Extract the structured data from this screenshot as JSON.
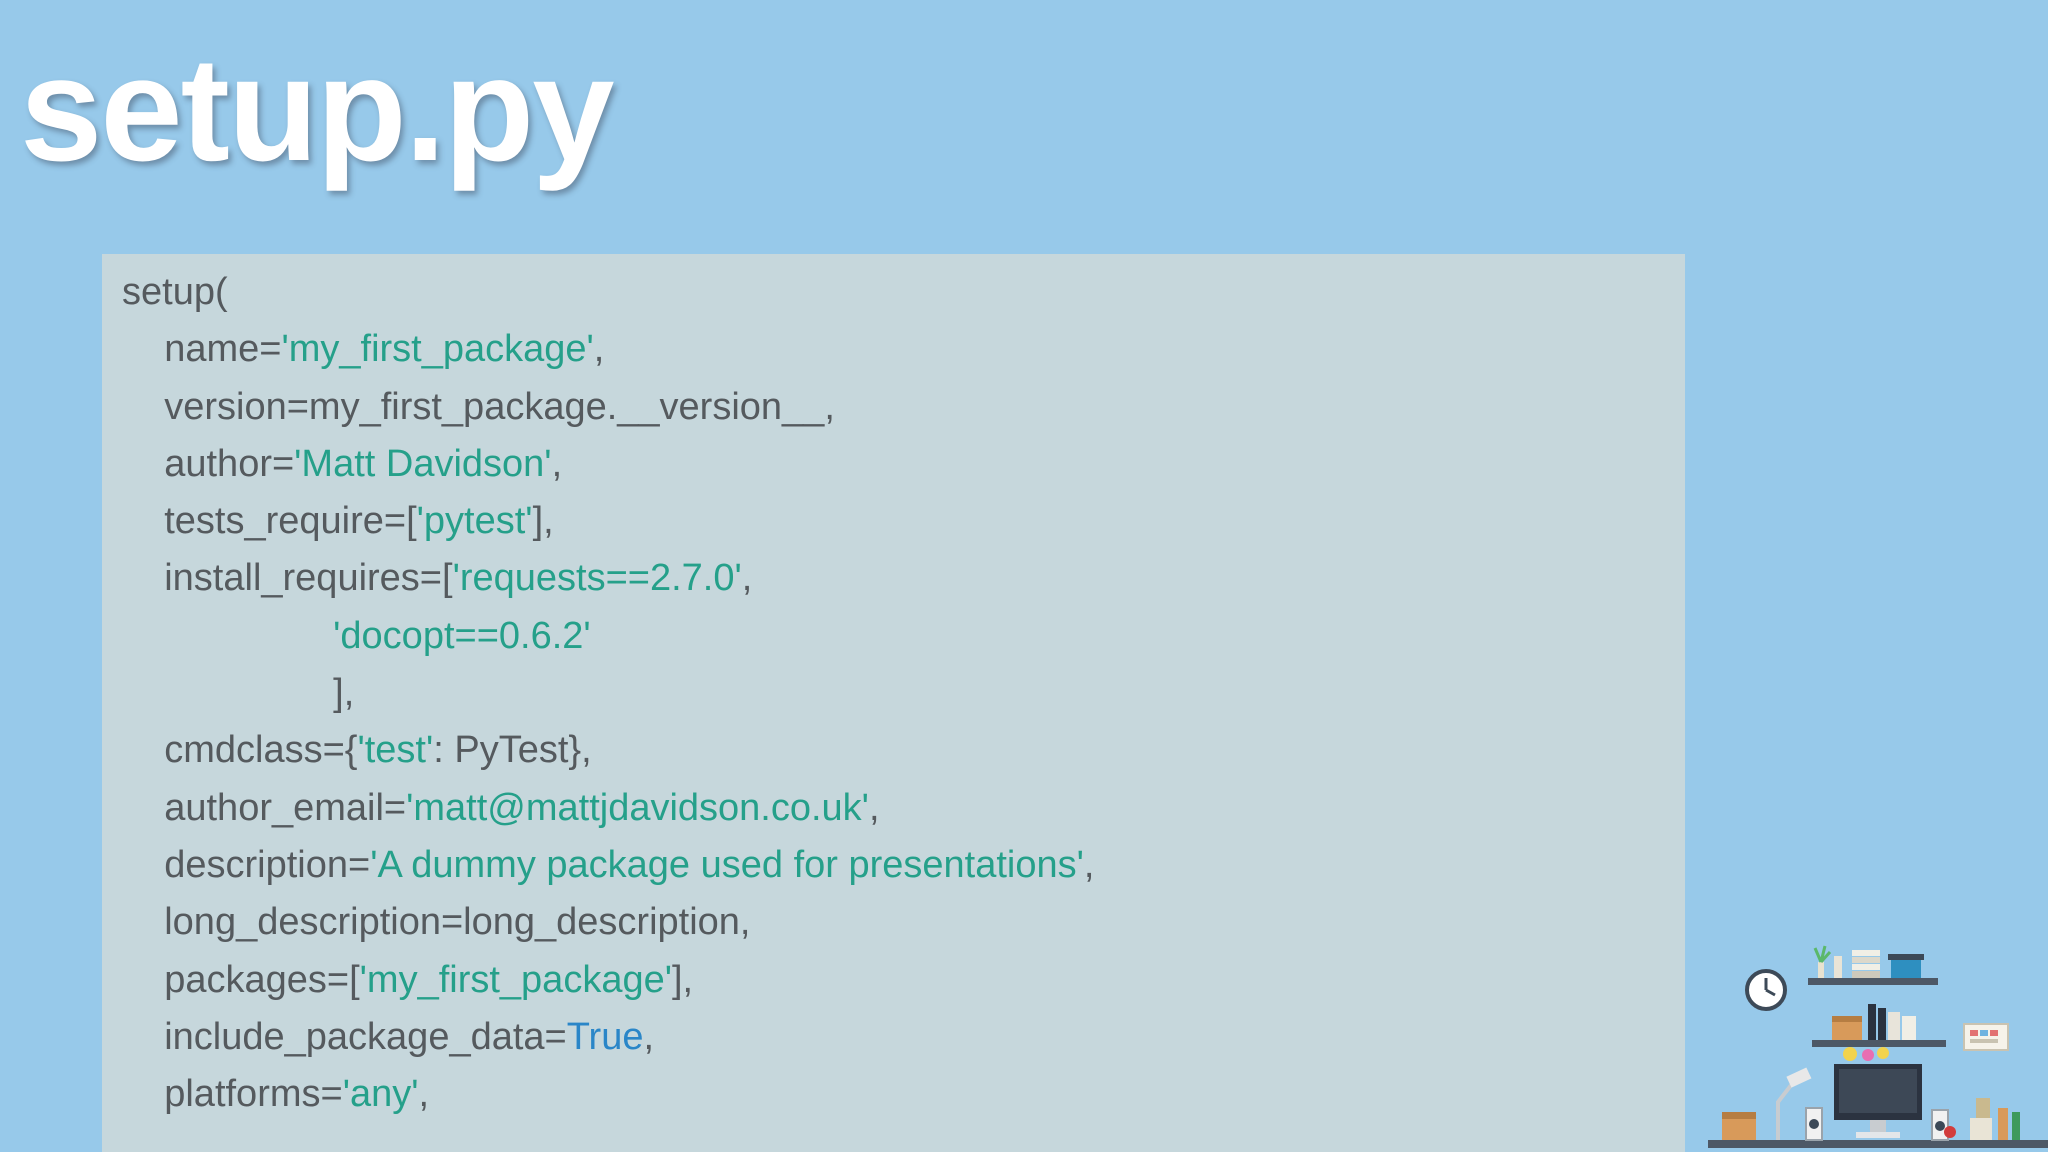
{
  "slide": {
    "title": "setup.py"
  },
  "code": {
    "lines": [
      {
        "tokens": [
          {
            "t": "setup(",
            "k": "plain"
          }
        ]
      },
      {
        "tokens": [
          {
            "t": "    name=",
            "k": "plain"
          },
          {
            "t": "'my_first_package'",
            "k": "str"
          },
          {
            "t": ",",
            "k": "plain"
          }
        ]
      },
      {
        "tokens": [
          {
            "t": "    version=my_first_package.__version__,",
            "k": "plain"
          }
        ]
      },
      {
        "tokens": [
          {
            "t": "    author=",
            "k": "plain"
          },
          {
            "t": "'Matt Davidson'",
            "k": "str"
          },
          {
            "t": ",",
            "k": "plain"
          }
        ]
      },
      {
        "tokens": [
          {
            "t": "    tests_require=[",
            "k": "plain"
          },
          {
            "t": "'pytest'",
            "k": "str"
          },
          {
            "t": "],",
            "k": "plain"
          }
        ]
      },
      {
        "tokens": [
          {
            "t": "    install_requires=[",
            "k": "plain"
          },
          {
            "t": "'requests==2.7.0'",
            "k": "str"
          },
          {
            "t": ",",
            "k": "plain"
          }
        ]
      },
      {
        "tokens": [
          {
            "t": "                    ",
            "k": "plain"
          },
          {
            "t": "'docopt==0.6.2'",
            "k": "str"
          }
        ]
      },
      {
        "tokens": [
          {
            "t": "                    ],",
            "k": "plain"
          }
        ]
      },
      {
        "tokens": [
          {
            "t": "    cmdclass={",
            "k": "plain"
          },
          {
            "t": "'test'",
            "k": "str"
          },
          {
            "t": ": PyTest},",
            "k": "plain"
          }
        ]
      },
      {
        "tokens": [
          {
            "t": "    author_email=",
            "k": "plain"
          },
          {
            "t": "'matt@mattjdavidson.co.uk'",
            "k": "str"
          },
          {
            "t": ",",
            "k": "plain"
          }
        ]
      },
      {
        "tokens": [
          {
            "t": "    description=",
            "k": "plain"
          },
          {
            "t": "'A dummy package used for presentations'",
            "k": "str"
          },
          {
            "t": ",",
            "k": "plain"
          }
        ]
      },
      {
        "tokens": [
          {
            "t": "    long_description=long_description,",
            "k": "plain"
          }
        ]
      },
      {
        "tokens": [
          {
            "t": "    packages=[",
            "k": "plain"
          },
          {
            "t": "'my_first_package'",
            "k": "str"
          },
          {
            "t": "],",
            "k": "plain"
          }
        ]
      },
      {
        "tokens": [
          {
            "t": "    include_package_data=",
            "k": "plain"
          },
          {
            "t": "True",
            "k": "kw"
          },
          {
            "t": ",",
            "k": "plain"
          }
        ]
      },
      {
        "tokens": [
          {
            "t": "    platforms=",
            "k": "plain"
          },
          {
            "t": "'any'",
            "k": "str"
          },
          {
            "t": ",",
            "k": "plain"
          }
        ]
      }
    ]
  },
  "colors": {
    "background": "#97c9ea",
    "code_background": "#c6d7dc",
    "plain_text": "#555a5e",
    "string_literal": "#25a08a",
    "keyword": "#2a86c8",
    "title_text": "#ffffff"
  },
  "illustration": {
    "icon": "office-desk-illustration"
  }
}
